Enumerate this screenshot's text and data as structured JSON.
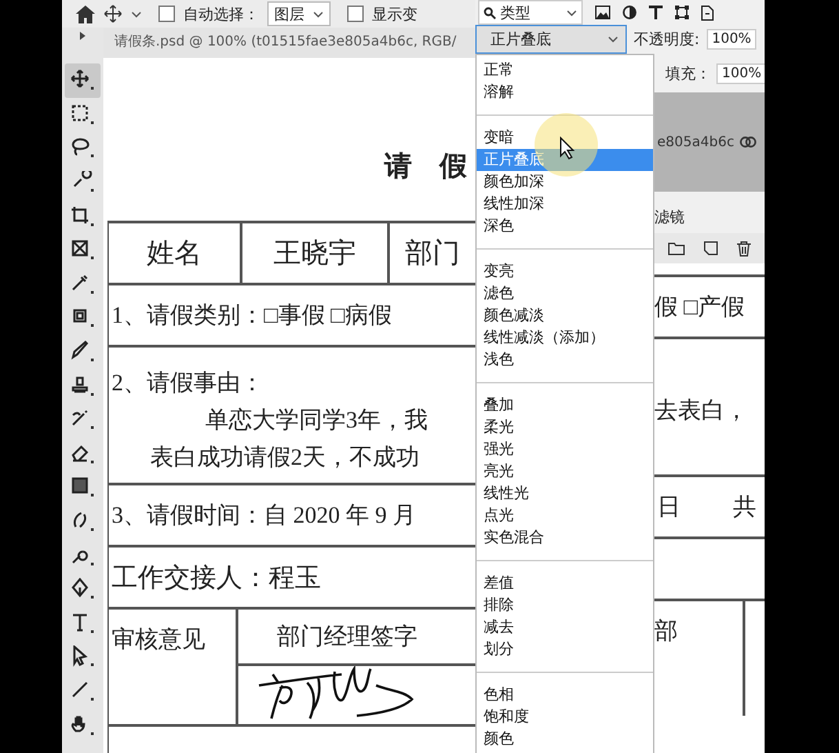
{
  "options_bar": {
    "auto_select": {
      "label": "自动选择：",
      "checked": false
    },
    "target": "图层",
    "show_transform": {
      "label": "显示变",
      "checked": false
    }
  },
  "document_tab": {
    "title": "请假条.psd @ 100% (t01515fae3e805a4b6c, RGB/"
  },
  "layers_panel": {
    "filter": "类型",
    "blend_mode": "正片叠底",
    "opacity_label": "不透明度:",
    "opacity": "100%",
    "fill_label": "填充：",
    "fill": "100%",
    "layer_name": "e805a4b6c",
    "filter_label": "滤镜"
  },
  "blend_menu": {
    "sections": [
      {
        "items": [
          {
            "label": "正常",
            "selected": false
          },
          {
            "label": "溶解",
            "selected": false
          }
        ]
      },
      {
        "items": [
          {
            "label": "变暗",
            "selected": false
          },
          {
            "label": "正片叠底",
            "selected": true
          },
          {
            "label": "颜色加深",
            "selected": false
          },
          {
            "label": "线性加深",
            "selected": false
          },
          {
            "label": "深色",
            "selected": false
          }
        ]
      },
      {
        "items": [
          {
            "label": "变亮",
            "selected": false
          },
          {
            "label": "滤色",
            "selected": false
          },
          {
            "label": "颜色减淡",
            "selected": false
          },
          {
            "label": "线性减淡（添加）",
            "selected": false
          },
          {
            "label": "浅色",
            "selected": false
          }
        ]
      },
      {
        "items": [
          {
            "label": "叠加",
            "selected": false
          },
          {
            "label": "柔光",
            "selected": false
          },
          {
            "label": "强光",
            "selected": false
          },
          {
            "label": "亮光",
            "selected": false
          },
          {
            "label": "线性光",
            "selected": false
          },
          {
            "label": "点光",
            "selected": false
          },
          {
            "label": "实色混合",
            "selected": false
          }
        ]
      },
      {
        "items": [
          {
            "label": "差值",
            "selected": false
          },
          {
            "label": "排除",
            "selected": false
          },
          {
            "label": "减去",
            "selected": false
          },
          {
            "label": "划分",
            "selected": false
          }
        ]
      },
      {
        "items": [
          {
            "label": "色相",
            "selected": false
          },
          {
            "label": "饱和度",
            "selected": false
          },
          {
            "label": "颜色",
            "selected": false
          }
        ]
      }
    ]
  },
  "document": {
    "title": "请　假",
    "header_cells": [
      "姓名",
      "王晓宇",
      "部门"
    ],
    "leave_type": "1、请假类别：□事假 □病假",
    "leave_type_cont": "假 □产假",
    "reason_label": "2、请假事由：",
    "reason_lines": [
      "单恋大学同学3年，我",
      "表白成功请假2天，不成功"
    ],
    "reason_cont": "去表白，",
    "time": "3、请假时间：自 2020 年 9 月",
    "time_cont": [
      "日",
      "共"
    ],
    "handover": "工作交接人：程玉",
    "audit_label": "审核意见",
    "manager_sign": "部门经理签字",
    "dept_cont": "部"
  }
}
